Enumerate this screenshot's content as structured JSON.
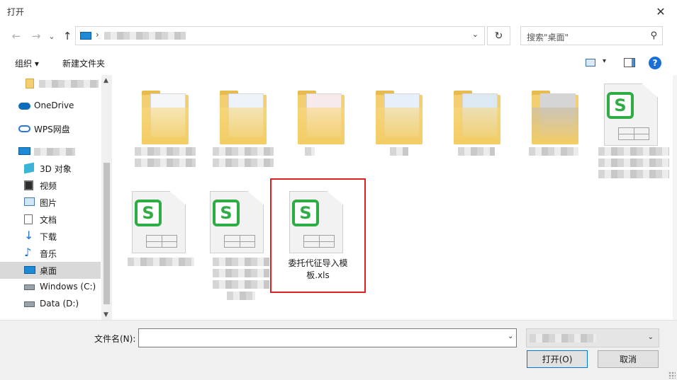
{
  "window": {
    "title": "打开",
    "close_glyph": "✕"
  },
  "nav": {
    "back_glyph": "←",
    "forward_glyph": "→",
    "recent_glyph": "⌄",
    "up_glyph": "↑"
  },
  "address": {
    "separator": "›",
    "dropdown_glyph": "⌄",
    "refresh_glyph": "↻"
  },
  "search": {
    "placeholder": "搜索\"桌面\"",
    "icon_glyph": "⚲"
  },
  "toolbar": {
    "organize": "组织 ▾",
    "new_folder": "新建文件夹",
    "view_drop": "▾",
    "help": "?"
  },
  "sidebar": {
    "items": [
      {
        "label": "",
        "icon": "folder-icon"
      },
      {
        "label": "OneDrive",
        "icon": "cloud-icon"
      },
      {
        "label": "WPS网盘",
        "icon": "cloud-icon"
      },
      {
        "label": "",
        "icon": "computer-icon"
      },
      {
        "label": "3D 对象",
        "icon": "cube-icon"
      },
      {
        "label": "视频",
        "icon": "film-icon"
      },
      {
        "label": "图片",
        "icon": "image-icon"
      },
      {
        "label": "文档",
        "icon": "document-icon"
      },
      {
        "label": "下载",
        "icon": "download-icon"
      },
      {
        "label": "音乐",
        "icon": "music-icon"
      },
      {
        "label": "桌面",
        "icon": "desktop-icon",
        "selected": true
      },
      {
        "label": "Windows (C:)",
        "icon": "drive-icon"
      },
      {
        "label": "Data (D:)",
        "icon": "drive-icon"
      }
    ],
    "scroll_up": "▲",
    "scroll_down": "▼"
  },
  "files": {
    "logo_letter": "S",
    "selected_file": {
      "name": "委托代征导入模板.xls",
      "line1": "委托代征导入模",
      "line2": "板.xls"
    }
  },
  "bottom": {
    "filename_label": "文件名(N):",
    "filename_value": "",
    "dropdown_glyph": "⌄",
    "open_button": "打开(O)",
    "cancel_button": "取消"
  },
  "colors": {
    "accent": "#0078d7",
    "selection_border": "#e02020",
    "wps_green": "#2fad45"
  }
}
